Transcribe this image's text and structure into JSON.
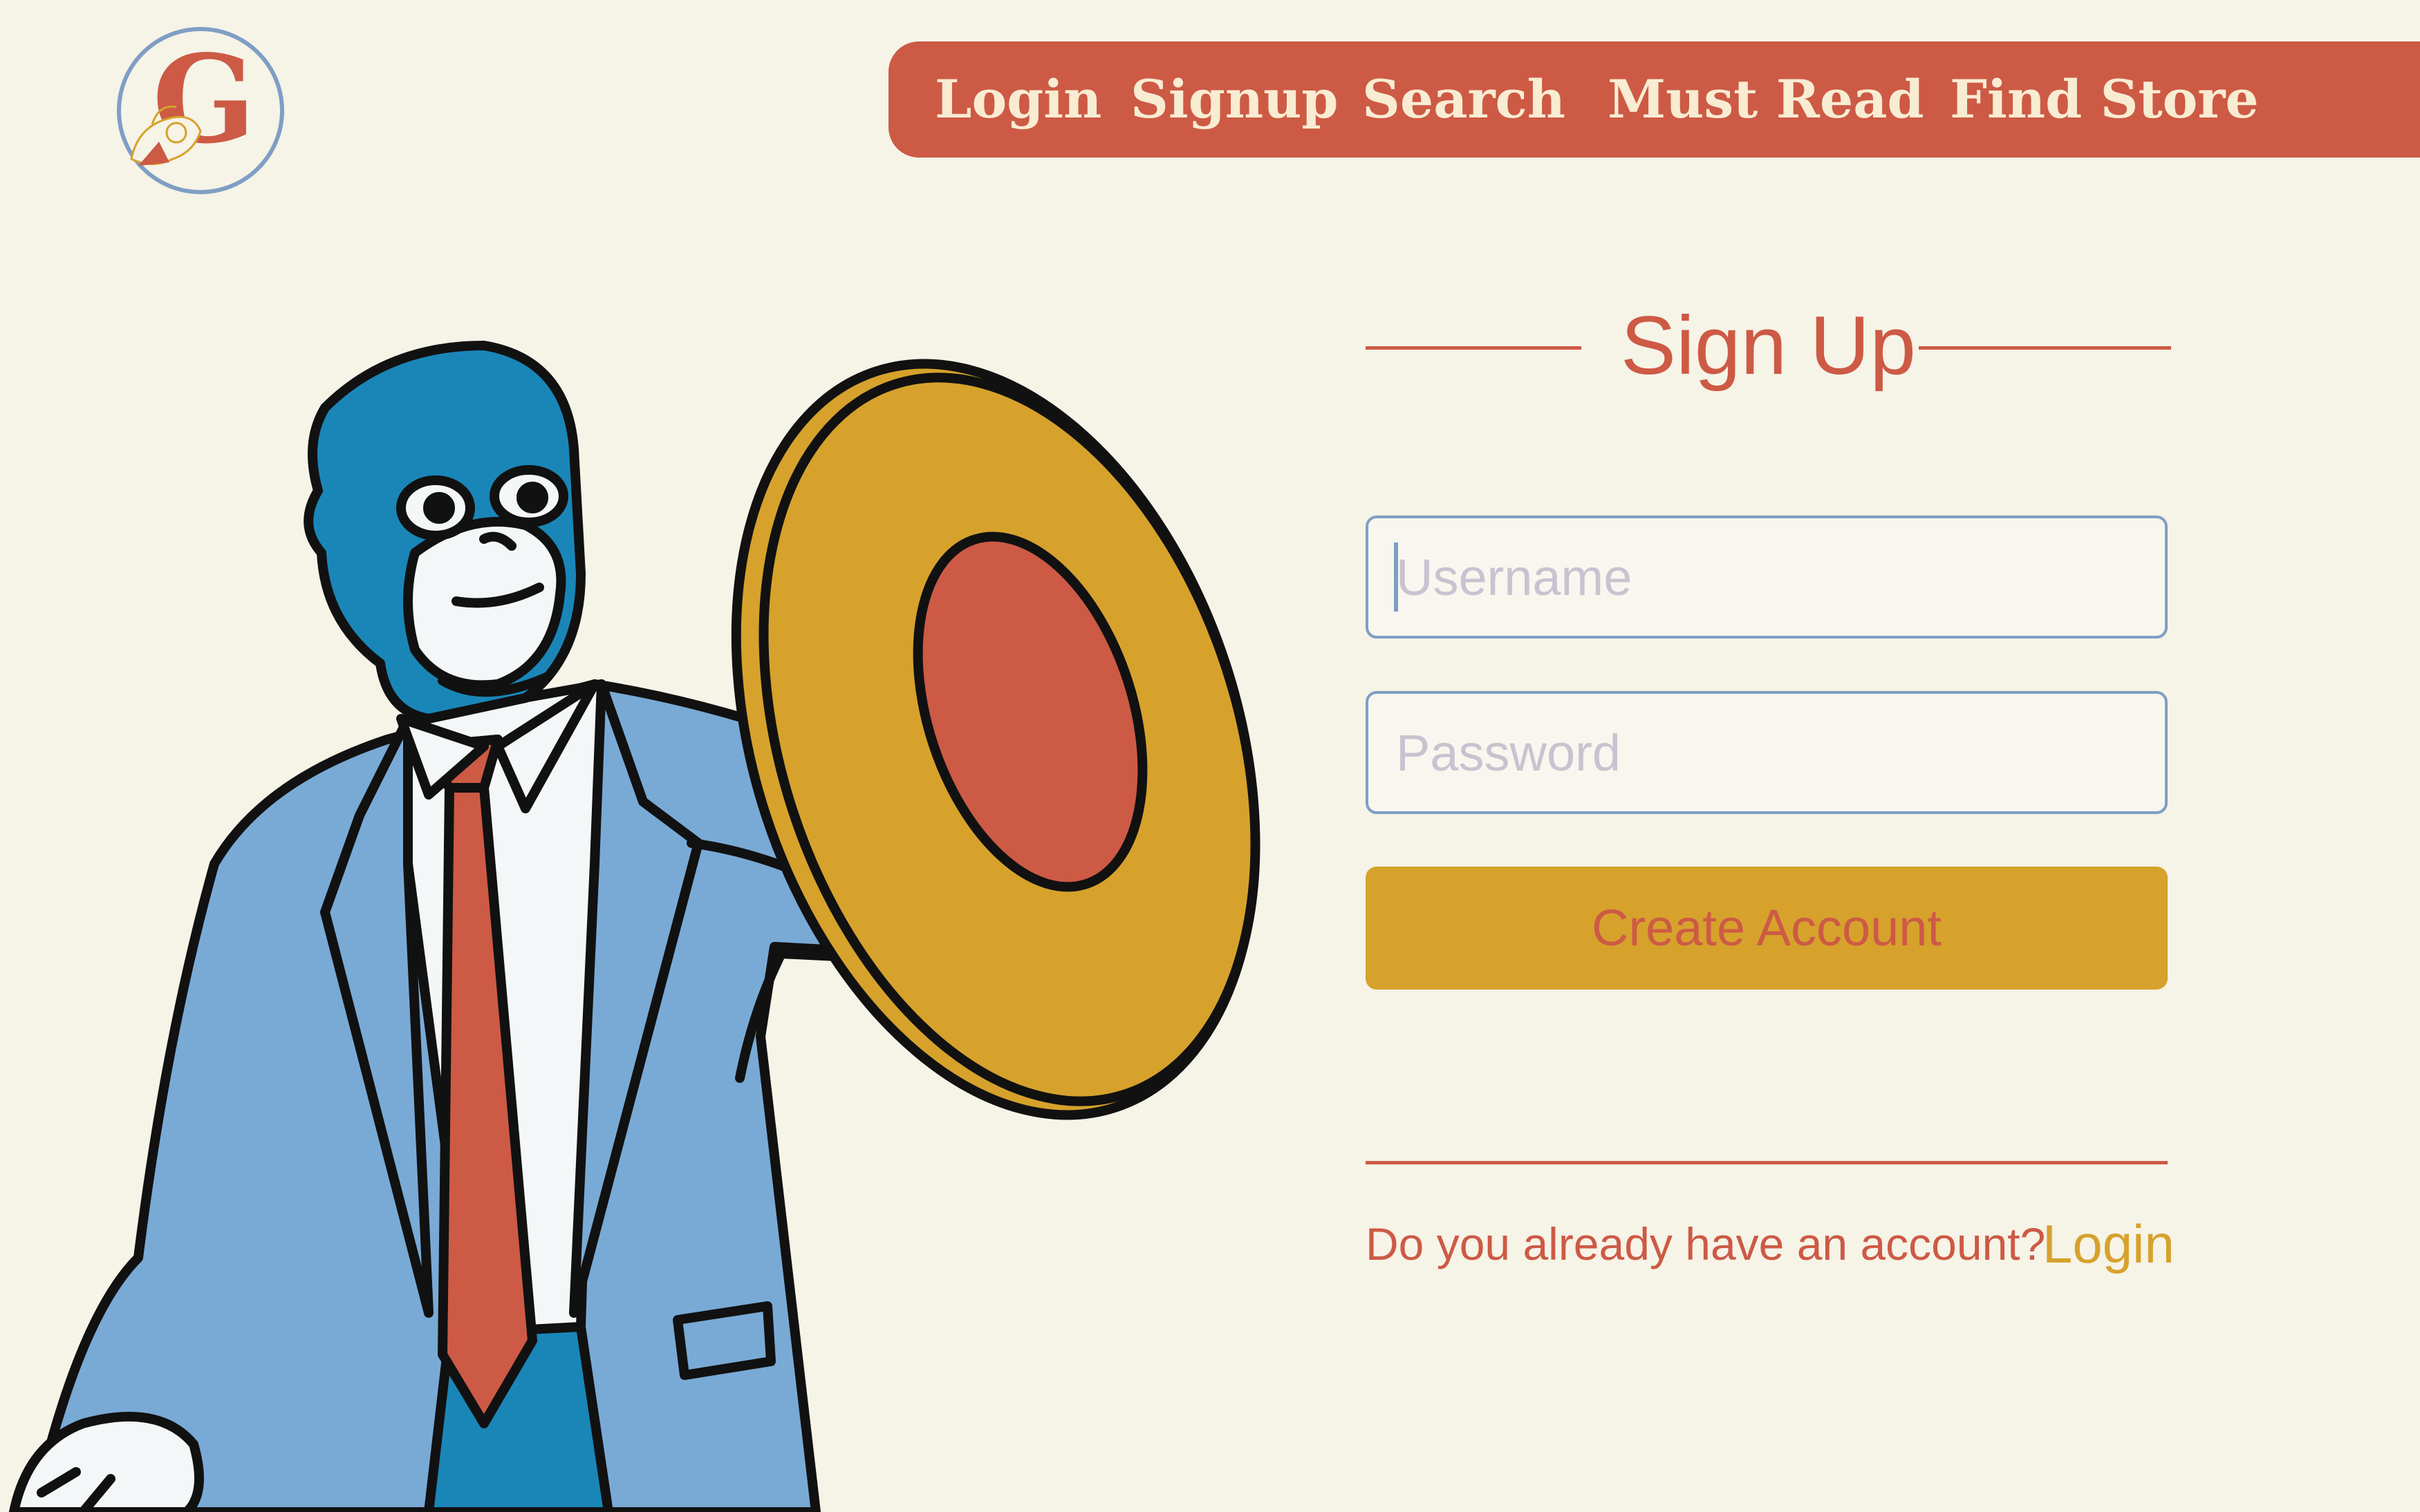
{
  "logo": {
    "letter": "G"
  },
  "nav": {
    "items": [
      {
        "label": "Login"
      },
      {
        "label": "Signup"
      },
      {
        "label": "Search"
      },
      {
        "label": "Must Read"
      },
      {
        "label": "Find Store"
      }
    ]
  },
  "signup": {
    "title": "Sign Up",
    "username_placeholder": "Username",
    "password_placeholder": "Password",
    "create_button": "Create Account",
    "prompt_text": "Do you already have an account?",
    "login_link": "Login"
  },
  "colors": {
    "background": "#f6f3e7",
    "brand_red": "#cd5a45",
    "accent_gold": "#d6a22c",
    "field_border": "#7f9ec4",
    "mask_blue": "#1a86b8",
    "suit_blue": "#79aad6"
  },
  "icons": {
    "logo": "brand-logo-icon",
    "illustration": "masked-hero-with-shield"
  }
}
